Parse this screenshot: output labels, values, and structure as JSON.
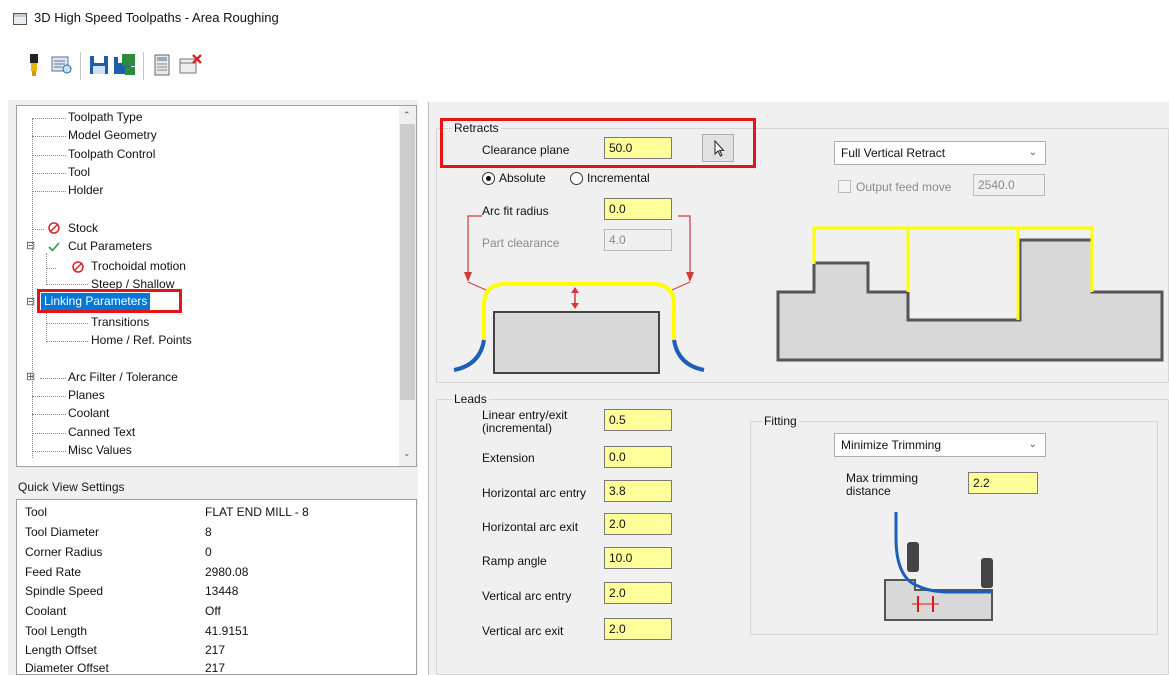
{
  "window": {
    "title": "3D High Speed Toolpaths - Area Roughing"
  },
  "toolbar": {
    "icons": [
      "tool-icon",
      "preview-icon",
      "save-icon",
      "save-all-icon",
      "calculator-icon",
      "cancel-icon"
    ]
  },
  "tree": {
    "items": [
      {
        "label": "Toolpath Type"
      },
      {
        "label": "Model Geometry"
      },
      {
        "label": "Toolpath Control"
      },
      {
        "label": "Tool"
      },
      {
        "label": "Holder"
      },
      {
        "label": "Stock"
      },
      {
        "label": "Cut Parameters"
      },
      {
        "label": "Trochoidal motion"
      },
      {
        "label": "Steep / Shallow"
      },
      {
        "label": "Linking Parameters"
      },
      {
        "label": "Transitions"
      },
      {
        "label": "Home / Ref. Points"
      },
      {
        "label": "Arc Filter / Tolerance"
      },
      {
        "label": "Planes"
      },
      {
        "label": "Coolant"
      },
      {
        "label": "Canned Text"
      },
      {
        "label": "Misc Values"
      }
    ],
    "expand_minus": "⊟",
    "expand_plus": "⊞"
  },
  "quick_view": {
    "title": "Quick View Settings",
    "rows": [
      {
        "key": "Tool",
        "value": "FLAT END MILL - 8"
      },
      {
        "key": "Tool Diameter",
        "value": "8"
      },
      {
        "key": "Corner Radius",
        "value": "0"
      },
      {
        "key": "Feed Rate",
        "value": "2980.08"
      },
      {
        "key": "Spindle Speed",
        "value": "13448"
      },
      {
        "key": "Coolant",
        "value": "Off"
      },
      {
        "key": "Tool Length",
        "value": "41.9151"
      },
      {
        "key": "Length Offset",
        "value": "217"
      },
      {
        "key": "Diameter Offset",
        "value": "217"
      }
    ]
  },
  "retracts": {
    "group_label": "Retracts",
    "clearance_plane_label": "Clearance plane",
    "clearance_plane_value": "50.0",
    "absolute_label": "Absolute",
    "incremental_label": "Incremental",
    "arc_fit_radius_label": "Arc fit radius",
    "arc_fit_radius_value": "0.0",
    "part_clearance_label": "Part clearance",
    "part_clearance_value": "4.0",
    "retract_type": "Full Vertical Retract",
    "output_feed_move_label": "Output feed move",
    "output_feed_move_value": "2540.0"
  },
  "leads": {
    "group_label": "Leads",
    "fields": [
      {
        "label": "Linear entry/exit\n(incremental)",
        "value": "0.5"
      },
      {
        "label": "Extension",
        "value": "0.0"
      },
      {
        "label": "Horizontal arc entry",
        "value": "3.8"
      },
      {
        "label": "Horizontal arc exit",
        "value": "2.0"
      },
      {
        "label": "Ramp angle",
        "value": "10.0"
      },
      {
        "label": "Vertical arc entry",
        "value": "2.0"
      },
      {
        "label": "Vertical arc exit",
        "value": "2.0"
      }
    ]
  },
  "fitting": {
    "group_label": "Fitting",
    "mode": "Minimize Trimming",
    "max_trimming_label": "Max trimming\ndistance",
    "max_trimming_value": "2.2"
  },
  "colors": {
    "highlight_red": "#e4141b",
    "input_yellow": "#ffff99",
    "diagram_yellow": "#ffff00",
    "diagram_blue": "#1c5fb8",
    "tree_selection": "#0078d7"
  }
}
